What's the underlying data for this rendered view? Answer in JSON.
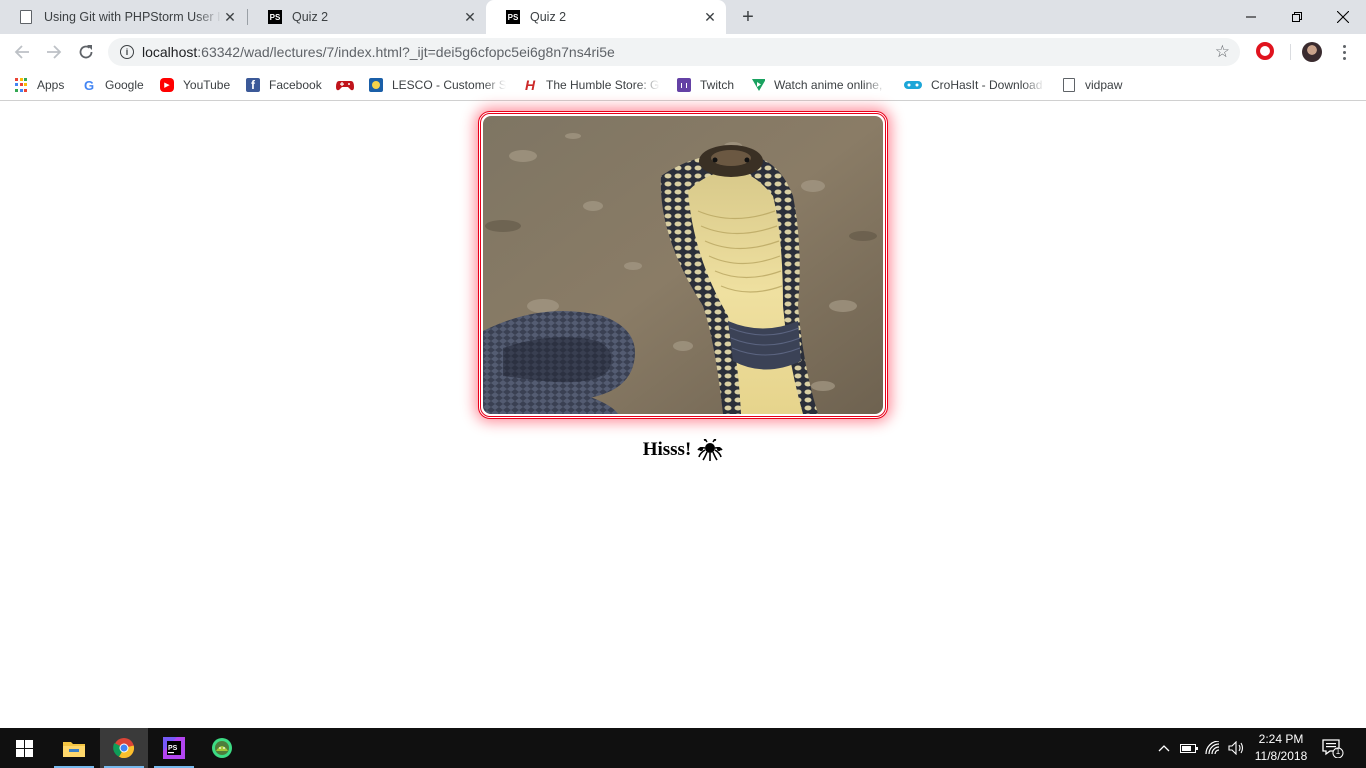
{
  "browser": {
    "tabs": [
      {
        "title": "Using Git with PHPStorm User Int",
        "icon": "document-icon",
        "active": false
      },
      {
        "title": "Quiz 2",
        "icon": "phpstorm-icon",
        "active": false
      },
      {
        "title": "Quiz 2",
        "icon": "phpstorm-icon",
        "active": true
      }
    ],
    "new_tab_symbol": "+",
    "window_controls": {
      "minimize": "—",
      "restore": "❐",
      "close": "✕"
    },
    "address": {
      "host": "localhost",
      "path": ":63342/wad/lectures/7/index.html?_ijt=dei5g6cfopc5ei6g8n7ns4ri5e"
    },
    "bookmarks": [
      {
        "label": "Apps",
        "icon": "apps-grid-icon"
      },
      {
        "label": "Google",
        "icon": "google-icon"
      },
      {
        "label": "YouTube",
        "icon": "youtube-icon"
      },
      {
        "label": "Facebook",
        "icon": "facebook-icon"
      },
      {
        "label": "",
        "icon": "gamepad-icon"
      },
      {
        "label": "LESCO - Customer Se",
        "icon": "lesco-icon"
      },
      {
        "label": "The Humble Store: G",
        "icon": "humble-icon"
      },
      {
        "label": "Twitch",
        "icon": "twitch-icon"
      },
      {
        "label": "Watch anime online,",
        "icon": "anime-icon"
      },
      {
        "label": "CroHasIt - Download",
        "icon": "crohasit-icon"
      },
      {
        "label": "vidpaw",
        "icon": "document-icon"
      }
    ]
  },
  "page": {
    "image_alt": "cobra",
    "frame_color": "#e8001a",
    "caption": "Hisss!",
    "caption_icon": "flying-spaghetti-monster-icon"
  },
  "taskbar": {
    "apps": [
      "windows-start-icon",
      "file-explorer-icon",
      "chrome-icon",
      "phpstorm-icon",
      "android-studio-icon"
    ],
    "time": "2:24 PM",
    "date": "11/8/2018",
    "notification_count": "1"
  }
}
